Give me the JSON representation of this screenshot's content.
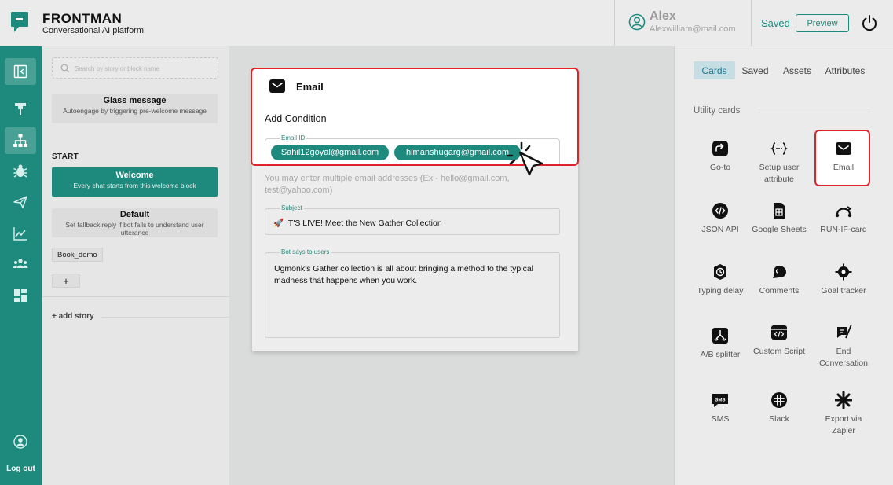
{
  "header": {
    "brand_title": "FRONTMAN",
    "brand_subtitle": "Conversational AI platform",
    "user_name": "Alex",
    "user_email": "Alexwilliam@mail.com",
    "saved_label": "Saved",
    "preview_label": "Preview"
  },
  "rail": {
    "logout_label": "Log out"
  },
  "story_panel": {
    "search_placeholder": "Search by story or block name",
    "glass_block": {
      "title": "Glass message",
      "subtitle": "Autoengage by triggering pre-welcome message"
    },
    "start_label": "START",
    "welcome_block": {
      "title": "Welcome",
      "subtitle": "Every chat starts from this welcome block"
    },
    "default_block": {
      "title": "Default",
      "subtitle": "Set fallback reply if bot fails to understand user utterance"
    },
    "book_demo_label": "Book_demo",
    "add_label": "+",
    "add_story_label": "+ add story"
  },
  "email_card": {
    "title": "Email",
    "add_condition_label": "Add Condition",
    "email_id_label": "Email ID",
    "emails": [
      "Sahil12goyal@gmail.com",
      "himanshugarg@gmail.com"
    ],
    "helper_text": "You may enter multiple email addresses (Ex - hello@gmail.com, test@yahoo.com)",
    "subject_label": "Subject",
    "subject_value": "🚀 IT'S LIVE! Meet the New Gather Collection",
    "bot_says_label": "Bot says to users",
    "bot_says_value": "Ugmonk's Gather collection is all about bringing a method to the typical madness that happens when you work."
  },
  "right_panel": {
    "tabs": [
      "Cards",
      "Saved",
      "Assets",
      "Attributes"
    ],
    "active_tab": "Cards",
    "section_label": "Utility cards",
    "utility_cards": [
      {
        "label": "Go-to",
        "icon": "goto-icon"
      },
      {
        "label": "Setup user attribute",
        "icon": "attribute-icon"
      },
      {
        "label": "Email",
        "icon": "email-icon"
      },
      {
        "label": "JSON API",
        "icon": "json-api-icon"
      },
      {
        "label": "Google Sheets",
        "icon": "google-sheets-icon"
      },
      {
        "label": "RUN-IF-card",
        "icon": "run-if-icon"
      },
      {
        "label": "Typing delay",
        "icon": "typing-delay-icon"
      },
      {
        "label": "Comments",
        "icon": "comments-icon"
      },
      {
        "label": "Goal tracker",
        "icon": "goal-tracker-icon"
      },
      {
        "label": "A/B splitter",
        "icon": "ab-splitter-icon"
      },
      {
        "label": "Custom Script",
        "icon": "custom-script-icon"
      },
      {
        "label": "End Conversation",
        "icon": "end-conversation-icon"
      },
      {
        "label": "SMS",
        "icon": "sms-icon"
      },
      {
        "label": "Slack",
        "icon": "slack-icon"
      },
      {
        "label": "Export via Zapier",
        "icon": "zapier-icon"
      }
    ]
  },
  "colors": {
    "brand": "#1e8a7d",
    "highlight": "#e0232b",
    "tab_active_bg": "#c7dde4"
  }
}
